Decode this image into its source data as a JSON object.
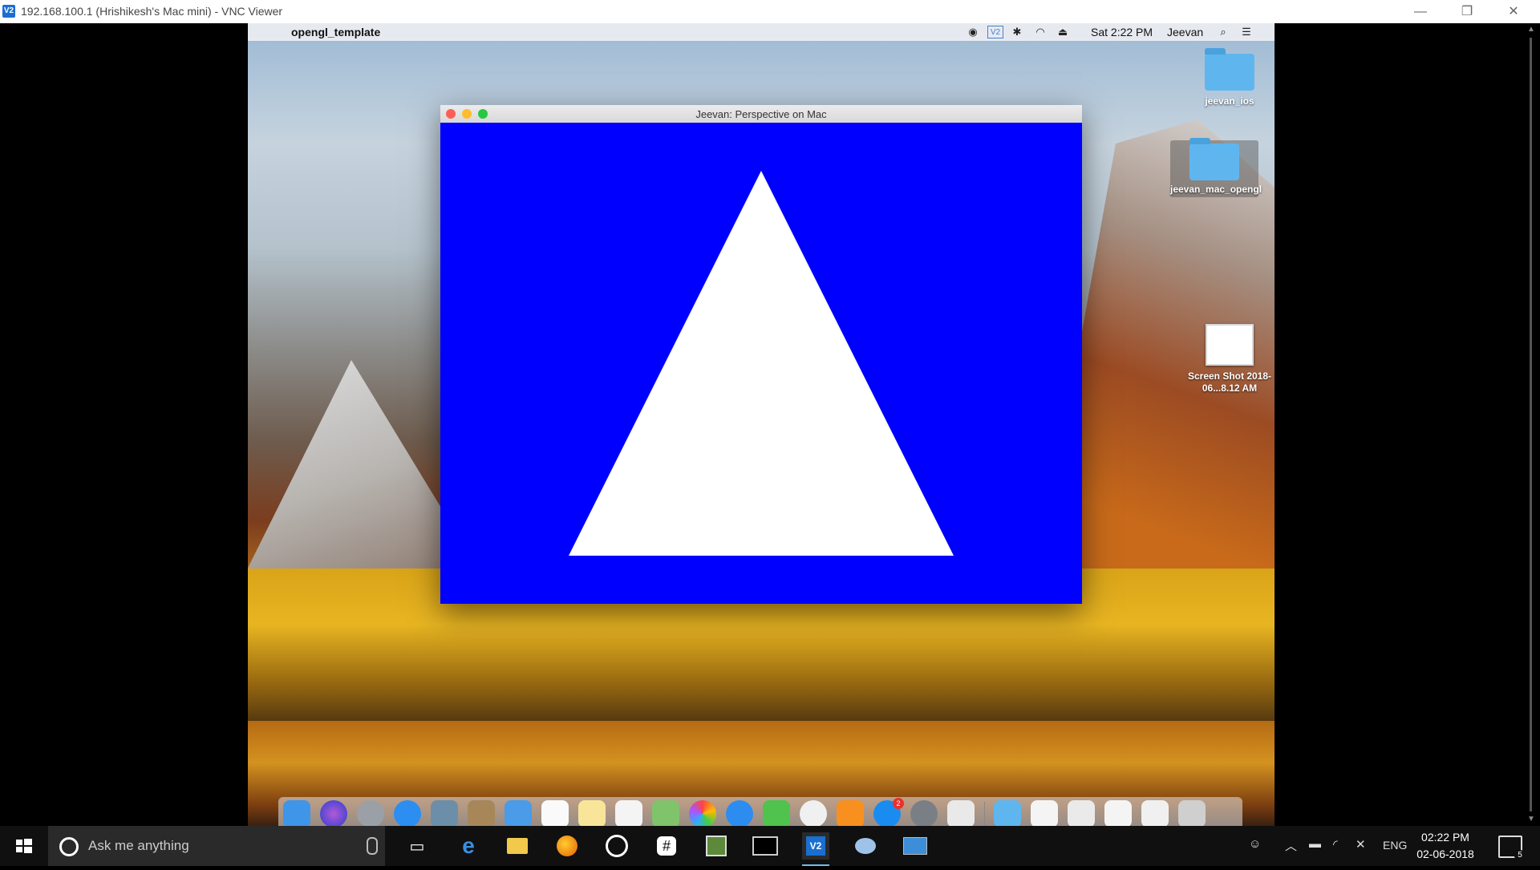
{
  "vnc": {
    "logo": "V2",
    "title": "192.168.100.1 (Hrishikesh's Mac mini) - VNC Viewer"
  },
  "mac": {
    "menubar": {
      "app_name": "opengl_template",
      "clock": "Sat 2:22 PM",
      "user": "Jeevan"
    },
    "desktop_icons": [
      {
        "label": "jeevan_ios",
        "kind": "folder"
      },
      {
        "label": "jeevan_mac_opengl",
        "kind": "folder"
      },
      {
        "label": "Screen Shot 2018-06...8.12 AM",
        "kind": "image"
      }
    ],
    "gl_window": {
      "title": "Jeevan: Perspective on Mac",
      "clear_color": "#0000ff",
      "triangle_color": "#ffffff"
    },
    "dock": {
      "app_store_badge": "2"
    }
  },
  "taskbar": {
    "search_placeholder": "Ask me anything",
    "language": "ENG",
    "time": "02:22 PM",
    "date": "02-06-2018",
    "notification_count": "5"
  }
}
